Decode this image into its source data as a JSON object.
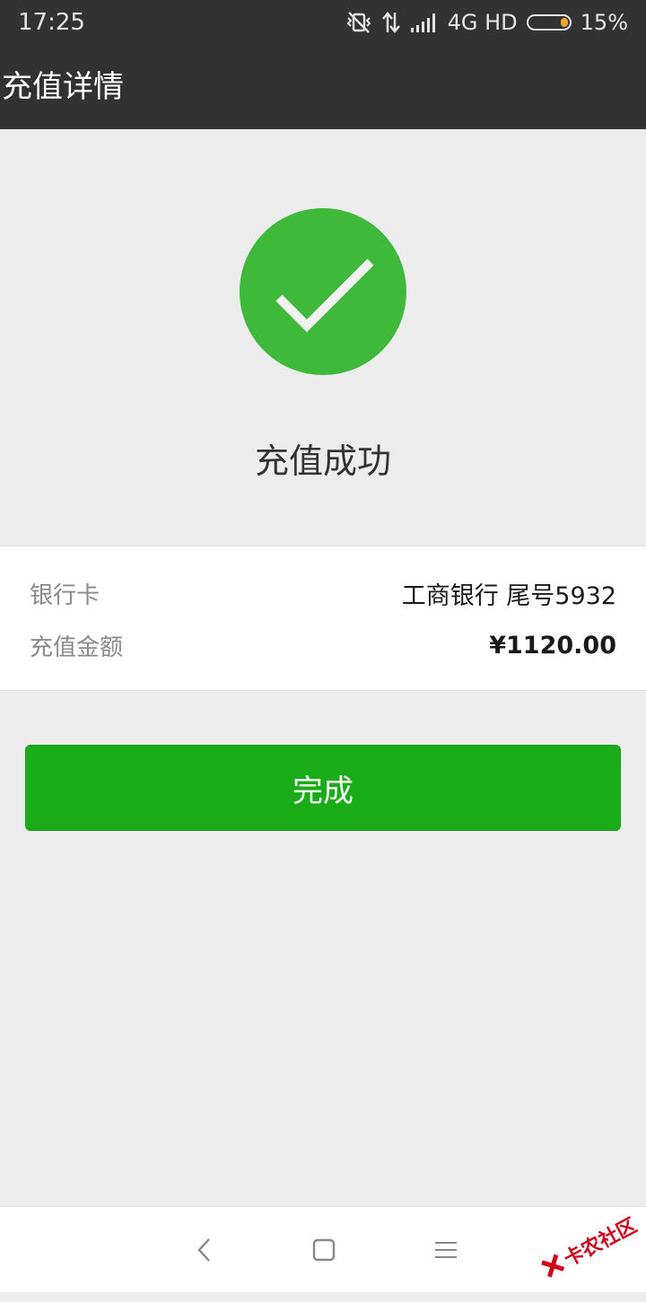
{
  "status_bar": {
    "time": "17:25",
    "network": "4G HD",
    "battery": "15%",
    "battery_level": 0.15,
    "icons": [
      "vibrate-off-icon",
      "data-transfer-icon",
      "signal-icon",
      "battery-icon"
    ]
  },
  "header": {
    "title": "充值详情"
  },
  "result": {
    "icon": "check-circle-icon",
    "icon_color": "#3eb93a",
    "message": "充值成功"
  },
  "details": {
    "bank_label": "银行卡",
    "bank_value": "工商银行 尾号5932",
    "amount_label": "充值金额",
    "amount_value": "¥1120.00"
  },
  "actions": {
    "done_label": "完成",
    "done_color": "#1aad19"
  },
  "nav": {
    "icons": [
      "back-icon",
      "home-icon",
      "menu-icon"
    ]
  },
  "watermark": {
    "text": "卡农社区"
  }
}
